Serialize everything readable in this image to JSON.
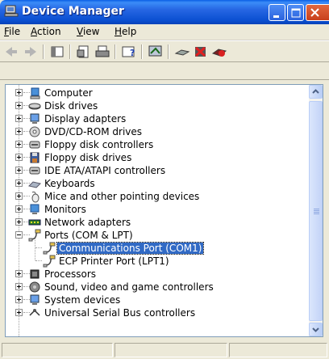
{
  "window": {
    "title": "Device Manager",
    "title_icon": "device-manager-icon"
  },
  "menubar": {
    "items": [
      {
        "key": "F",
        "rest": "ile"
      },
      {
        "key": "A",
        "rest": "ction"
      },
      {
        "key": "V",
        "rest": "iew"
      },
      {
        "key": "H",
        "rest": "elp"
      }
    ]
  },
  "toolbar": {
    "buttons": [
      "back-arrow-icon",
      "forward-arrow-icon",
      "console-tree-icon",
      "properties-icon",
      "print-icon",
      "help-icon",
      "scan-hardware-icon",
      "update-driver-icon",
      "uninstall-icon",
      "disable-icon"
    ]
  },
  "tree": {
    "items": [
      {
        "label": "Computer",
        "icon": "computer-icon",
        "expander": "plus"
      },
      {
        "label": "Disk drives",
        "icon": "disk-drive-icon",
        "expander": "plus"
      },
      {
        "label": "Display adapters",
        "icon": "display-adapter-icon",
        "expander": "plus"
      },
      {
        "label": "DVD/CD-ROM drives",
        "icon": "cdrom-icon",
        "expander": "plus"
      },
      {
        "label": "Floppy disk controllers",
        "icon": "floppy-controller-icon",
        "expander": "plus"
      },
      {
        "label": "Floppy disk drives",
        "icon": "floppy-drive-icon",
        "expander": "plus"
      },
      {
        "label": "IDE ATA/ATAPI controllers",
        "icon": "ide-controller-icon",
        "expander": "plus"
      },
      {
        "label": "Keyboards",
        "icon": "keyboard-icon",
        "expander": "plus"
      },
      {
        "label": "Mice and other pointing devices",
        "icon": "mouse-icon",
        "expander": "plus"
      },
      {
        "label": "Monitors",
        "icon": "monitor-icon",
        "expander": "plus"
      },
      {
        "label": "Network adapters",
        "icon": "network-adapter-icon",
        "expander": "plus"
      },
      {
        "label": "Ports (COM & LPT)",
        "icon": "port-icon",
        "expander": "minus",
        "children": [
          {
            "label": "Communications Port (COM1)",
            "icon": "port-icon",
            "selected": true
          },
          {
            "label": "ECP Printer Port (LPT1)",
            "icon": "port-icon",
            "selected": false
          }
        ]
      },
      {
        "label": "Processors",
        "icon": "processor-icon",
        "expander": "plus"
      },
      {
        "label": "Sound, video and game controllers",
        "icon": "sound-icon",
        "expander": "plus"
      },
      {
        "label": "System devices",
        "icon": "system-device-icon",
        "expander": "plus"
      },
      {
        "label": "Universal Serial Bus controllers",
        "icon": "usb-icon",
        "expander": "plus"
      }
    ]
  },
  "colors": {
    "titlebar": "#0a4fd0",
    "selection": "#316ac5",
    "chrome": "#ece9d8"
  }
}
